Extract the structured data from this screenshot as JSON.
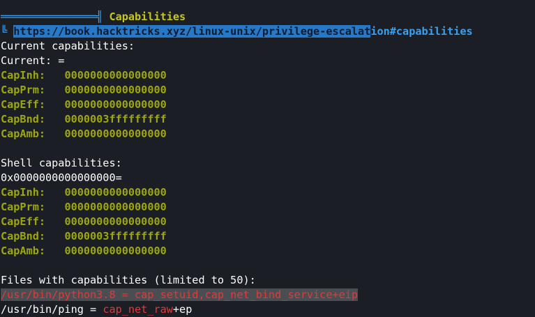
{
  "section": {
    "title": "Capabilities",
    "link_highlighted": "https://book.hacktricks.xyz/linux-unix/privilege-escalat",
    "link_tail": "ion#capabilities"
  },
  "current": {
    "heading": "Current capabilities:",
    "current_line": "Current: =",
    "caps": [
      {
        "name": "CapInh:",
        "value": "0000000000000000"
      },
      {
        "name": "CapPrm:",
        "value": "0000000000000000"
      },
      {
        "name": "CapEff:",
        "value": "0000000000000000"
      },
      {
        "name": "CapBnd:",
        "value": "0000003fffffffff"
      },
      {
        "name": "CapAmb:",
        "value": "0000000000000000"
      }
    ]
  },
  "shell": {
    "heading": "Shell capabilities:",
    "hex_line": "0x0000000000000000=",
    "caps": [
      {
        "name": "CapInh:",
        "value": "0000000000000000"
      },
      {
        "name": "CapPrm:",
        "value": "0000000000000000"
      },
      {
        "name": "CapEff:",
        "value": "0000000000000000"
      },
      {
        "name": "CapBnd:",
        "value": "0000003fffffffff"
      },
      {
        "name": "CapAmb:",
        "value": "0000000000000000"
      }
    ]
  },
  "files": {
    "heading": "Files with capabilities (limited to 50):",
    "entry1": "/usr/bin/python3.8 = cap_setuid,cap_net_bind_service+eip",
    "entry2_path": "/usr/bin/ping = ",
    "entry2_cap": "cap_net_raw",
    "entry2_tail": "+ep"
  }
}
